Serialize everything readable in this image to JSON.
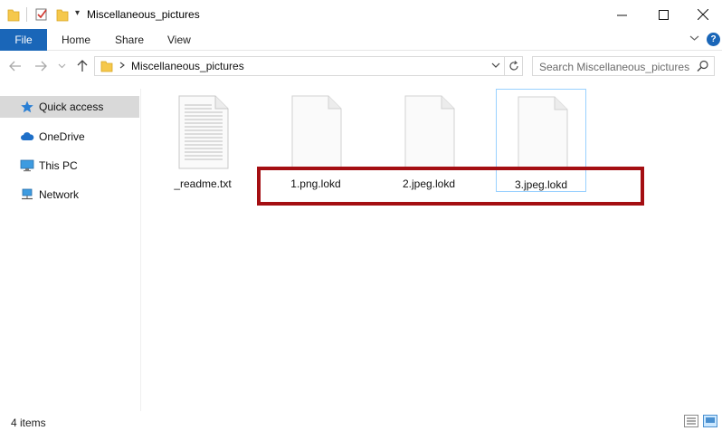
{
  "window": {
    "title": "Miscellaneous_pictures",
    "quick_access_toolbar_arrow": "▾"
  },
  "ribbon": {
    "tabs": [
      {
        "label": "File"
      },
      {
        "label": "Home"
      },
      {
        "label": "Share"
      },
      {
        "label": "View"
      }
    ]
  },
  "address_bar": {
    "path": "Miscellaneous_pictures",
    "search_placeholder": "Search Miscellaneous_pictures"
  },
  "sidebar": {
    "items": [
      {
        "label": "Quick access",
        "icon": "star-icon",
        "selected": true
      },
      {
        "label": "OneDrive",
        "icon": "cloud-icon",
        "selected": false
      },
      {
        "label": "This PC",
        "icon": "computer-icon",
        "selected": false
      },
      {
        "label": "Network",
        "icon": "network-icon",
        "selected": false
      }
    ]
  },
  "files": [
    {
      "name": "_readme.txt",
      "type": "text",
      "selected": false
    },
    {
      "name": "1.png.lokd",
      "type": "blank",
      "selected": false
    },
    {
      "name": "2.jpeg.lokd",
      "type": "blank",
      "selected": false
    },
    {
      "name": "3.jpeg.lokd",
      "type": "blank",
      "selected": true
    }
  ],
  "status": {
    "item_count": "4 items"
  },
  "colors": {
    "accent": "#1a66b8",
    "highlight_box": "#a40e12",
    "selection_border": "#99d1ff",
    "sidebar_selected": "#d9d9d9"
  }
}
